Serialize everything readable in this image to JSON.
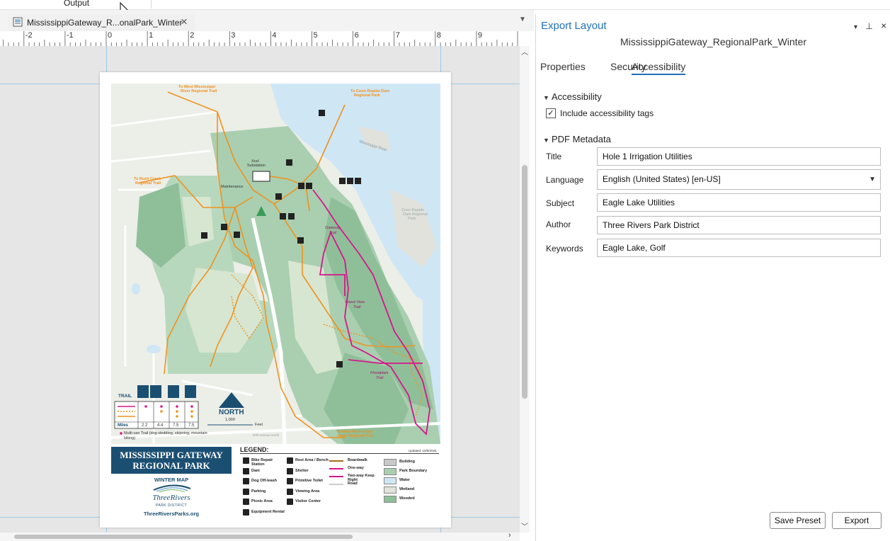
{
  "app": {
    "output_label": "Output"
  },
  "document_tab": {
    "label": "MississippiGateway_R...onalPark_Winter"
  },
  "ruler": {
    "ticks": [
      "-2",
      "-1",
      "0",
      "1",
      "2",
      "3",
      "4",
      "5",
      "6",
      "7",
      "8",
      "9"
    ]
  },
  "map": {
    "title_line1": "MISSISSIPPI GATEWAY",
    "title_line2": "REGIONAL PARK",
    "subtitle": "WINTER MAP",
    "org_name": "ThreeRivers",
    "org_sub": "PARK DISTRICT",
    "website": "ThreeRiversParks.org",
    "north": "NORTH",
    "scale_value": "1,000",
    "scale_unit": "Feet",
    "legend_title": "LEGEND:",
    "updated": "Updated: 10/8/2025",
    "trail_label": "TRAIL",
    "miles_label": "Miles",
    "miles": [
      "2.2",
      "4.4",
      "7.5",
      "7.5"
    ],
    "multiuse_note": "Multi-use Trail (dog sledding, skijoring, mountain biking)",
    "labels": {
      "to_west_upper": "To West Mississippi River Regional Trail",
      "to_coon": "To Coon Rapids Dam Regional Park",
      "to_rush": "To Rush Creek Regional Trail",
      "to_west_lower": "To West Mississippi River Regional Trail",
      "xcel": "Xcel Substation",
      "maintenance": "Maintenance",
      "gateway_trail": "Gateway Trail",
      "island_view": "Island View Trail",
      "floodplain": "Floodplain Trail",
      "mississippi": "Mississippi River",
      "coon_rapids": "Coon Rapids Dam Regional Park",
      "avenue": "97th Avenue North"
    },
    "legend": [
      {
        "label": "Bike Repair Station",
        "symbol": "B"
      },
      {
        "label": "Dam",
        "symbol": "D"
      },
      {
        "label": "Dog Off-leash",
        "symbol": "d"
      },
      {
        "label": "Parking",
        "symbol": "P"
      },
      {
        "label": "Picnic Area",
        "symbol": "A"
      },
      {
        "label": "Equipment Rental",
        "symbol": "R"
      },
      {
        "label": "Rest Area / Bench",
        "symbol": "+"
      },
      {
        "label": "Shelter",
        "symbol": "S"
      },
      {
        "label": "Primitive Toilet",
        "symbol": "T"
      },
      {
        "label": "Viewing Area",
        "symbol": "V"
      },
      {
        "label": "Visitor Center",
        "symbol": "C"
      }
    ],
    "legend_lines": [
      {
        "label": "Boardwalk",
        "color": "#a86a1a"
      },
      {
        "label": "One-way",
        "color": "#d6168c"
      },
      {
        "label": "Two-way Keep Right",
        "color": "#d6168c"
      },
      {
        "label": "Road",
        "color": "#cccccc"
      }
    ],
    "legend_areas": [
      {
        "label": "Building",
        "color": "#c9c9c9"
      },
      {
        "label": "Park Boundary",
        "color": "#a9cfb0"
      },
      {
        "label": "Water",
        "color": "#cfe6f5"
      },
      {
        "label": "Wetland",
        "color": "#e2e2dc"
      },
      {
        "label": "Wooded",
        "color": "#8fbf99"
      }
    ]
  },
  "panel": {
    "title": "Export Layout",
    "subtitle": "MississippiGateway_RegionalPark_Winter",
    "tabs": [
      {
        "label": "Properties",
        "active": false
      },
      {
        "label": "Security",
        "active": false
      },
      {
        "label": "Accessibility",
        "active": true
      }
    ],
    "sections": {
      "accessibility": "Accessibility",
      "pdf_metadata": "PDF Metadata"
    },
    "include_tags_label": "Include accessibility tags",
    "include_tags_checked": true,
    "fields": {
      "title_label": "Title",
      "title_value": "Hole 1 Irrigation Utilities",
      "language_label": "Language",
      "language_value": "English (United States) [en-US]",
      "subject_label": "Subject",
      "subject_value": "Eagle Lake Utilities",
      "author_label": "Author",
      "author_value": "Three Rivers Park District",
      "keywords_label": "Keywords",
      "keywords_value": "Eagle Lake, Golf"
    },
    "buttons": {
      "save_preset": "Save Preset",
      "export": "Export"
    }
  },
  "colors": {
    "accent": "#1e6fba",
    "map_navy": "#1b4f72",
    "trail_orange": "#f0921e",
    "trail_magenta": "#d6168c"
  }
}
